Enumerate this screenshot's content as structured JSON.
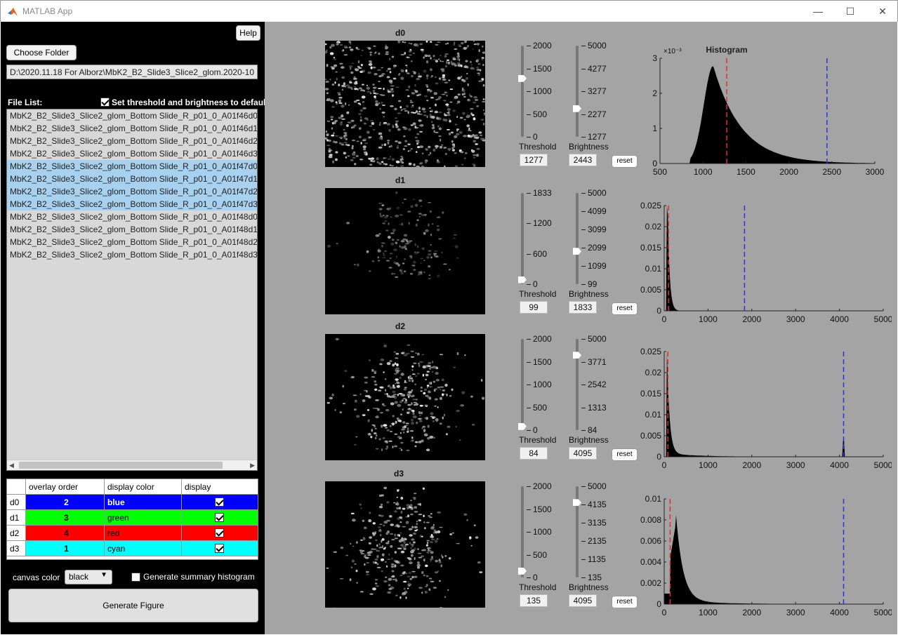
{
  "window": {
    "title": "MATLAB App",
    "minimize": "—",
    "maximize": "☐",
    "close": "✕"
  },
  "left": {
    "help_label": "Help",
    "choose_folder_label": "Choose Folder",
    "folder_path": "D:\\2020.11.18 For Alborz\\MbK2_B2_Slide3_Slice2_glom.2020-10",
    "file_list_label": "File List:",
    "default_checkbox_label": "Set threshold and brightness to default",
    "default_checked": true,
    "files": [
      {
        "name": "MbK2_B2_Slide3_Slice2_glom_Bottom Slide_R_p01_0_A01f46d0",
        "selected": false
      },
      {
        "name": "MbK2_B2_Slide3_Slice2_glom_Bottom Slide_R_p01_0_A01f46d1",
        "selected": false
      },
      {
        "name": "MbK2_B2_Slide3_Slice2_glom_Bottom Slide_R_p01_0_A01f46d2",
        "selected": false
      },
      {
        "name": "MbK2_B2_Slide3_Slice2_glom_Bottom Slide_R_p01_0_A01f46d3",
        "selected": false
      },
      {
        "name": "MbK2_B2_Slide3_Slice2_glom_Bottom Slide_R_p01_0_A01f47d0",
        "selected": true
      },
      {
        "name": "MbK2_B2_Slide3_Slice2_glom_Bottom Slide_R_p01_0_A01f47d1",
        "selected": true
      },
      {
        "name": "MbK2_B2_Slide3_Slice2_glom_Bottom Slide_R_p01_0_A01f47d2",
        "selected": true
      },
      {
        "name": "MbK2_B2_Slide3_Slice2_glom_Bottom Slide_R_p01_0_A01f47d3",
        "selected": true
      },
      {
        "name": "MbK2_B2_Slide3_Slice2_glom_Bottom Slide_R_p01_0_A01f48d0",
        "selected": false
      },
      {
        "name": "MbK2_B2_Slide3_Slice2_glom_Bottom Slide_R_p01_0_A01f48d1",
        "selected": false
      },
      {
        "name": "MbK2_B2_Slide3_Slice2_glom_Bottom Slide_R_p01_0_A01f48d2",
        "selected": false
      },
      {
        "name": "MbK2_B2_Slide3_Slice2_glom_Bottom Slide_R_p01_0_A01f48d3",
        "selected": false
      }
    ],
    "table": {
      "headers": [
        "",
        "overlay order",
        "display color",
        "display"
      ],
      "rows": [
        {
          "channel": "d0",
          "order": "2",
          "color": "blue",
          "bg": "#0000ff",
          "fg": "#ffffff",
          "display": true
        },
        {
          "channel": "d1",
          "order": "3",
          "color": "green",
          "bg": "#00ff00",
          "fg": "#000000",
          "display": true
        },
        {
          "channel": "d2",
          "order": "4",
          "color": "red",
          "bg": "#ff0000",
          "fg": "#000000",
          "display": true
        },
        {
          "channel": "d3",
          "order": "1",
          "color": "cyan",
          "bg": "#00ffff",
          "fg": "#000000",
          "display": true
        }
      ]
    },
    "canvas_color_label": "canvas color",
    "canvas_color_value": "black",
    "summary_hist_label": "Generate summary histogram",
    "summary_hist_checked": false,
    "generate_label": "Generate Figure"
  },
  "channels": [
    {
      "name": "d0",
      "threshold_ticks": [
        "2000",
        "1500",
        "1000",
        "500",
        "0"
      ],
      "threshold_level": 0.64,
      "brightness_ticks": [
        "5000",
        "4277",
        "3277",
        "2277",
        "1277"
      ],
      "brightness_level": 0.31,
      "threshold_label": "Threshold",
      "brightness_label": "Brightness",
      "threshold_value": "1277",
      "brightness_value": "2443",
      "reset_label": "reset",
      "hist": {
        "title": "Histogram",
        "exponent": "×10⁻³",
        "xlim": [
          500,
          3000
        ],
        "xticks": [
          "500",
          "1000",
          "1500",
          "2000",
          "2500",
          "3000"
        ],
        "ylim": [
          0,
          3
        ],
        "yticks": [
          "0",
          "1",
          "2",
          "3"
        ],
        "shape": "d0",
        "red_x": 1277,
        "blue_x": 2443
      }
    },
    {
      "name": "d1",
      "threshold_ticks": [
        "1833",
        "1200",
        "600",
        "0"
      ],
      "threshold_level": 0.05,
      "brightness_ticks": [
        "5000",
        "4099",
        "3099",
        "2099",
        "1099",
        "99"
      ],
      "brightness_level": 0.36,
      "threshold_label": "Threshold",
      "brightness_label": "Brightness",
      "threshold_value": "99",
      "brightness_value": "1833",
      "reset_label": "reset",
      "hist": {
        "title": "",
        "exponent": "",
        "xlim": [
          0,
          5000
        ],
        "xticks": [
          "0",
          "1000",
          "2000",
          "3000",
          "4000",
          "5000"
        ],
        "ylim": [
          0,
          0.025
        ],
        "yticks": [
          "0",
          "0.005",
          "0.01",
          "0.015",
          "0.02",
          "0.025"
        ],
        "shape": "d1",
        "red_x": 99,
        "blue_x": 1833
      }
    },
    {
      "name": "d2",
      "threshold_ticks": [
        "2000",
        "1500",
        "1000",
        "500",
        "0"
      ],
      "threshold_level": 0.04,
      "brightness_ticks": [
        "5000",
        "3771",
        "2542",
        "1313",
        "84"
      ],
      "brightness_level": 0.82,
      "threshold_label": "Threshold",
      "brightness_label": "Brightness",
      "threshold_value": "84",
      "brightness_value": "4095",
      "reset_label": "reset",
      "hist": {
        "title": "",
        "exponent": "",
        "xlim": [
          0,
          5000
        ],
        "xticks": [
          "0",
          "1000",
          "2000",
          "3000",
          "4000",
          "5000"
        ],
        "ylim": [
          0,
          0.025
        ],
        "yticks": [
          "0",
          "0.005",
          "0.01",
          "0.015",
          "0.02",
          "0.025"
        ],
        "shape": "d2",
        "red_x": 84,
        "blue_x": 4095
      }
    },
    {
      "name": "d3",
      "threshold_ticks": [
        "2000",
        "1500",
        "1000",
        "500",
        "0"
      ],
      "threshold_level": 0.07,
      "brightness_ticks": [
        "5000",
        "4135",
        "3135",
        "2135",
        "1135",
        "135"
      ],
      "brightness_level": 0.82,
      "threshold_label": "Threshold",
      "brightness_label": "Brightness",
      "threshold_value": "135",
      "brightness_value": "4095",
      "reset_label": "reset",
      "hist": {
        "title": "",
        "exponent": "",
        "xlim": [
          0,
          5000
        ],
        "xticks": [
          "0",
          "1000",
          "2000",
          "3000",
          "4000",
          "5000"
        ],
        "ylim": [
          0,
          0.01
        ],
        "yticks": [
          "0",
          "0.002",
          "0.004",
          "0.006",
          "0.008",
          "0.01"
        ],
        "shape": "d3",
        "red_x": 135,
        "blue_x": 4095
      }
    }
  ]
}
